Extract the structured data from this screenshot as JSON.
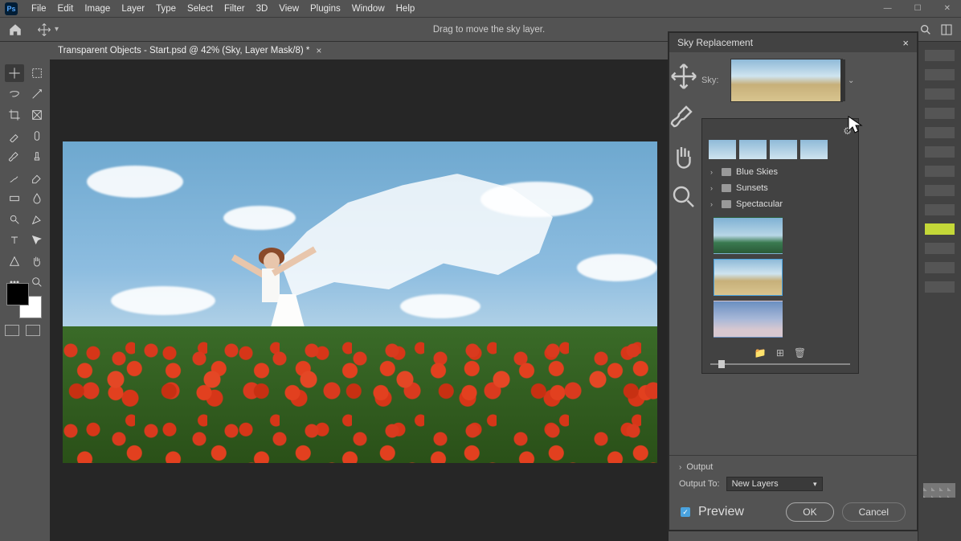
{
  "menubar": {
    "items": [
      "File",
      "Edit",
      "Image",
      "Layer",
      "Type",
      "Select",
      "Filter",
      "3D",
      "View",
      "Plugins",
      "Window",
      "Help"
    ]
  },
  "optbar": {
    "tip": "Drag to move the sky layer."
  },
  "tab": {
    "title": "Transparent Objects - Start.psd @ 42% (Sky, Layer Mask/8) *"
  },
  "dialog": {
    "title": "Sky Replacement",
    "sky_label": "Sky:",
    "folders": [
      "Blue Skies",
      "Sunsets",
      "Spectacular"
    ],
    "output_header": "Output",
    "output_to_label": "Output To:",
    "output_to_value": "New Layers",
    "preview_label": "Preview",
    "ok": "OK",
    "cancel": "Cancel"
  }
}
